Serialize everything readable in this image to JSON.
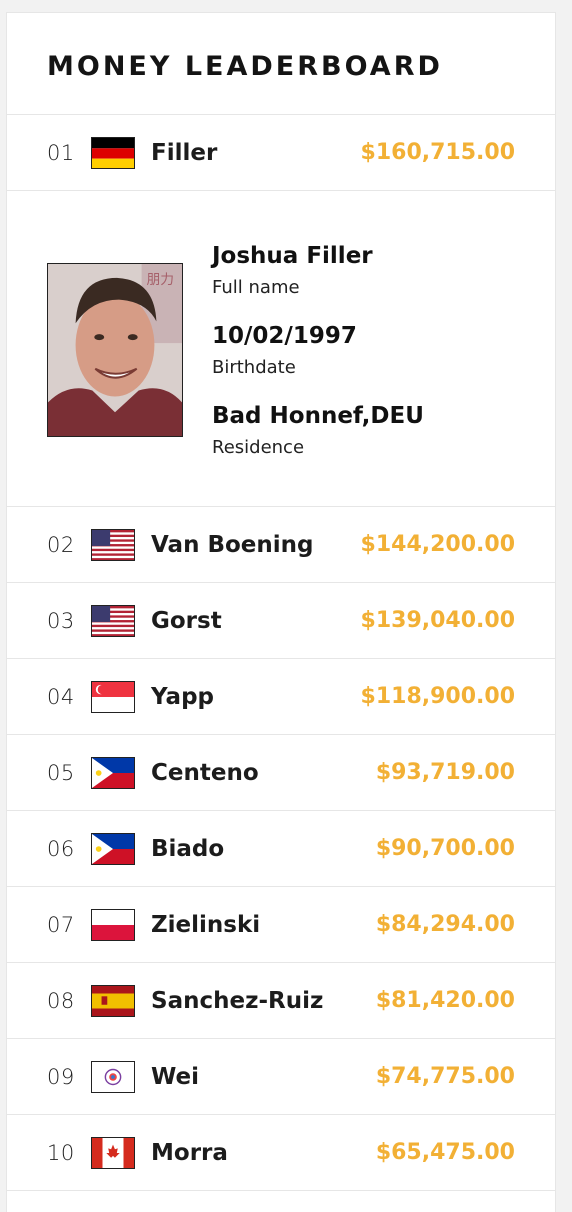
{
  "title": "MONEY LEADERBOARD",
  "accent_color": "#f2b035",
  "rows": [
    {
      "rank": "01",
      "flag": "germany-flag-icon",
      "name": "Filler",
      "money": "$160,715.00"
    },
    {
      "rank": "02",
      "flag": "usa-flag-icon",
      "name": "Van Boening",
      "money": "$144,200.00"
    },
    {
      "rank": "03",
      "flag": "usa-flag-icon",
      "name": "Gorst",
      "money": "$139,040.00"
    },
    {
      "rank": "04",
      "flag": "singapore-flag-icon",
      "name": "Yapp",
      "money": "$118,900.00"
    },
    {
      "rank": "05",
      "flag": "philippines-flag-icon",
      "name": "Centeno",
      "money": "$93,719.00"
    },
    {
      "rank": "06",
      "flag": "philippines-flag-icon",
      "name": "Biado",
      "money": "$90,700.00"
    },
    {
      "rank": "07",
      "flag": "poland-flag-icon",
      "name": "Zielinski",
      "money": "$84,294.00"
    },
    {
      "rank": "08",
      "flag": "spain-flag-icon",
      "name": "Sanchez-Ruiz",
      "money": "$81,420.00"
    },
    {
      "rank": "09",
      "flag": "chinese-taipei-flag-icon",
      "name": "Wei",
      "money": "$74,775.00"
    },
    {
      "rank": "10",
      "flag": "canada-flag-icon",
      "name": "Morra",
      "money": "$65,475.00"
    }
  ],
  "detail": {
    "full_name": "Joshua Filler",
    "full_name_label": "Full name",
    "birthdate": "10/02/1997",
    "birthdate_label": "Birthdate",
    "residence": "Bad Honnef,DEU",
    "residence_label": "Residence",
    "photo": "player-photo"
  }
}
